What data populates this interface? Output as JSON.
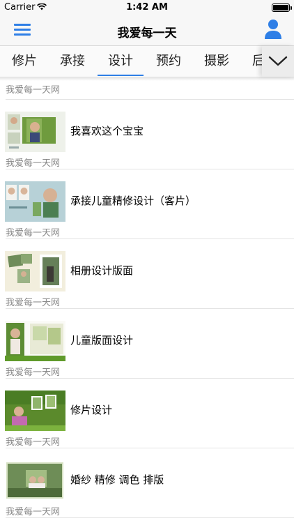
{
  "status": {
    "carrier": "Carrier",
    "time": "1:42 AM"
  },
  "nav": {
    "title": "我爱每一天"
  },
  "tabs": [
    "修片",
    "承接",
    "设计",
    "预约",
    "摄影",
    "后"
  ],
  "list": {
    "top_source": "我爱每一天网",
    "items": [
      {
        "title": "我喜欢这个宝宝",
        "source": "我爱每一天网"
      },
      {
        "title": "承接儿童精修设计（客片）",
        "source": "我爱每一天网"
      },
      {
        "title": "相册设计版面",
        "source": "我爱每一天网"
      },
      {
        "title": "儿童版面设计",
        "source": "我爱每一天网"
      },
      {
        "title": "修片设计",
        "source": "我爱每一天网"
      },
      {
        "title": "婚纱 精修 调色 排版",
        "source": "我爱每一天网"
      }
    ]
  },
  "colors": {
    "accent": "#2f7fe6"
  }
}
